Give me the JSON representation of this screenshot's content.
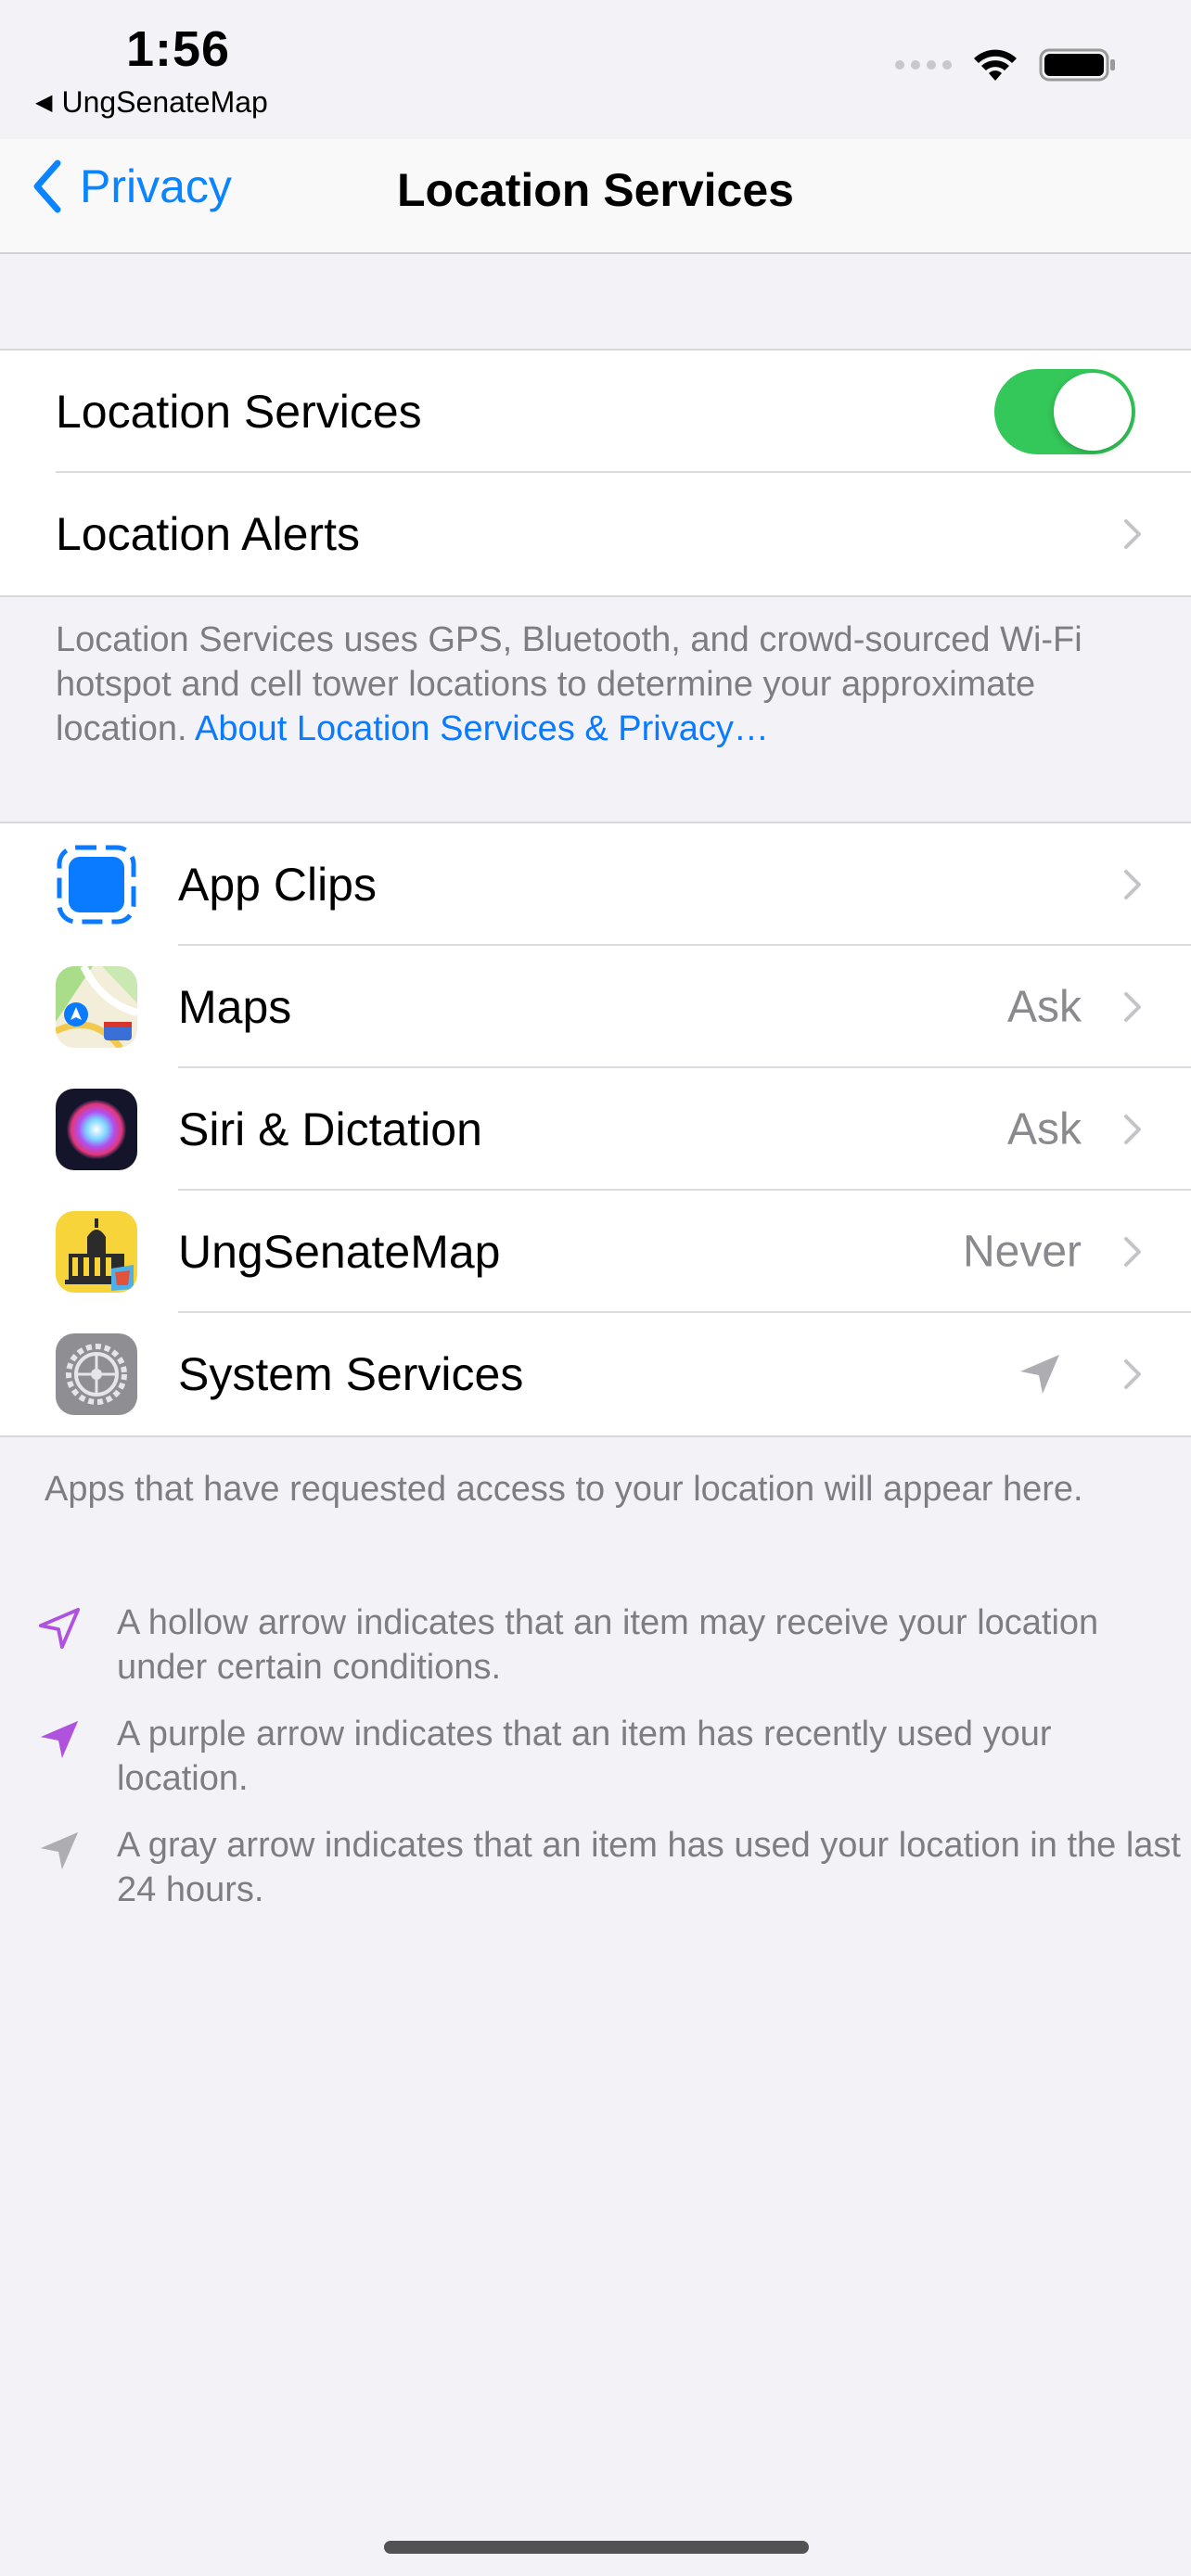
{
  "status_bar": {
    "time": "1:56",
    "back_app": "UngSenateMap"
  },
  "nav": {
    "back_label": "Privacy",
    "title": "Location Services"
  },
  "main_group": {
    "location_services_label": "Location Services",
    "location_services_on": true,
    "location_alerts_label": "Location Alerts"
  },
  "info": {
    "text": "Location Services uses GPS, Bluetooth, and crowd-sourced Wi-Fi hotspot and cell tower locations to determine your approximate location.",
    "link": "About Location Services & Privacy…"
  },
  "apps": [
    {
      "label": "App Clips",
      "value": "",
      "icon": "app-clips-icon"
    },
    {
      "label": "Maps",
      "value": "Ask",
      "icon": "maps-icon"
    },
    {
      "label": "Siri & Dictation",
      "value": "Ask",
      "icon": "siri-icon"
    },
    {
      "label": "UngSenateMap",
      "value": "Never",
      "icon": "ungsenatemap-icon"
    },
    {
      "label": "System Services",
      "value": "",
      "icon": "settings-gear-icon"
    }
  ],
  "footer": {
    "intro": "Apps that have requested access to your location will appear here.",
    "legend": [
      {
        "icon": "hollow-arrow-icon",
        "color": "#af52de",
        "text": "A hollow arrow indicates that an item may receive your location under certain conditions."
      },
      {
        "icon": "purple-arrow-icon",
        "color": "#af52de",
        "text": "A purple arrow indicates that an item has recently used your location."
      },
      {
        "icon": "gray-arrow-icon",
        "color": "#aeaeb2",
        "text": "A gray arrow indicates that an item has used your location in the last 24 hours."
      }
    ]
  },
  "colors": {
    "accent": "#0a84ff",
    "toggle_on": "#34c759",
    "background": "#f2f2f7"
  }
}
